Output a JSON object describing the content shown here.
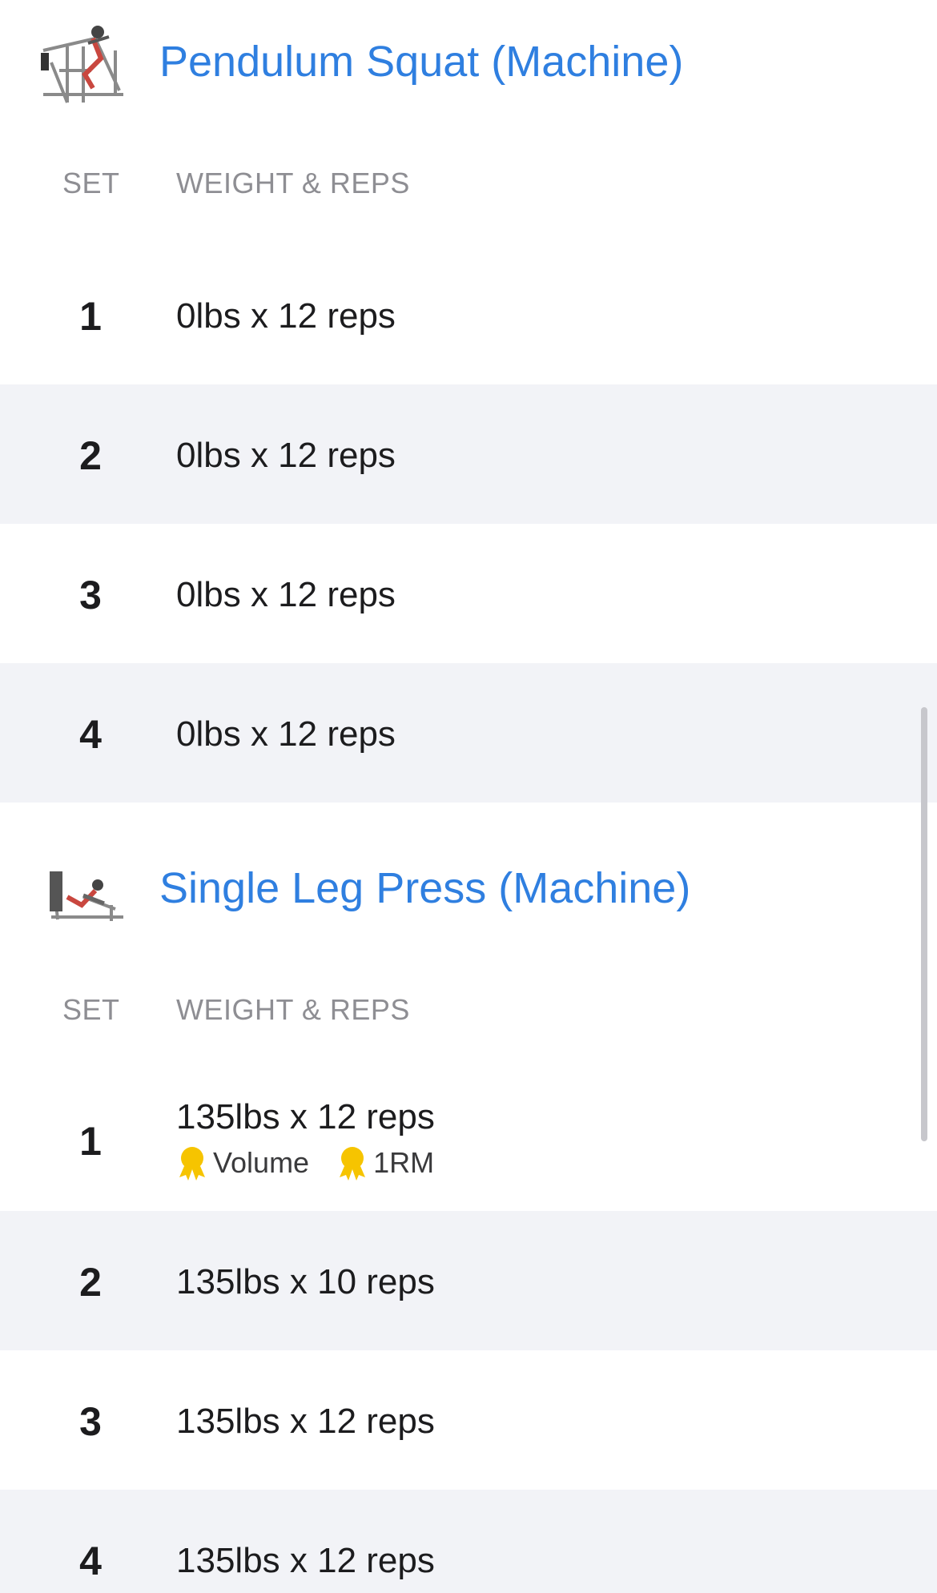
{
  "exercises": [
    {
      "title": "Pendulum Squat (Machine)",
      "thumb_icon": "pendulum-squat-machine-illustration",
      "col_set": "SET",
      "col_weight_reps": "WEIGHT & REPS",
      "sets": [
        {
          "num": "1",
          "text": "0lbs x 12 reps"
        },
        {
          "num": "2",
          "text": "0lbs x 12 reps"
        },
        {
          "num": "3",
          "text": "0lbs x 12 reps"
        },
        {
          "num": "4",
          "text": "0lbs x 12 reps"
        }
      ]
    },
    {
      "title": "Single Leg Press (Machine)",
      "thumb_icon": "single-leg-press-machine-illustration",
      "col_set": "SET",
      "col_weight_reps": "WEIGHT & REPS",
      "sets": [
        {
          "num": "1",
          "text": "135lbs x 12 reps",
          "records": [
            "Volume",
            "1RM"
          ]
        },
        {
          "num": "2",
          "text": "135lbs x 10 reps"
        },
        {
          "num": "3",
          "text": "135lbs x 12 reps"
        },
        {
          "num": "4",
          "text": "135lbs x 12 reps"
        }
      ]
    }
  ],
  "colors": {
    "accent": "#2f7fe0",
    "row_alt": "#f2f3f7",
    "medal": "#f6c400"
  }
}
